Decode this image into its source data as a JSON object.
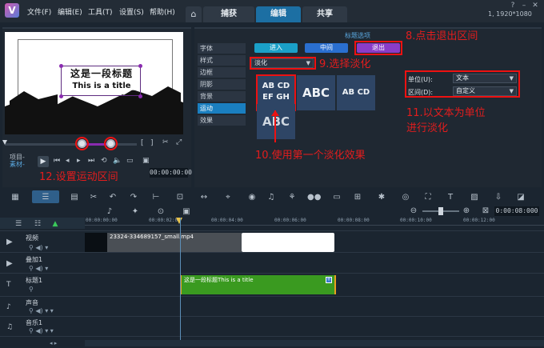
{
  "app": {
    "logo": "V",
    "resolution": "1, 1920*1080"
  },
  "menu": [
    "文件(F)",
    "编辑(E)",
    "工具(T)",
    "设置(S)",
    "帮助(H)"
  ],
  "nav_tabs": [
    "捕获",
    "编辑",
    "共享"
  ],
  "preview": {
    "title_line1": "这是一段标题",
    "title_line2": "This is a title",
    "project_label": "项目-",
    "clip_label": "素材-",
    "timecode": "00:00:00:00"
  },
  "annotations": {
    "a8": "8.点击退出区间",
    "a9": "9.选择淡化",
    "a10": "10.使用第一个淡化效果",
    "a11_line1": "11.以文本为单位",
    "a11_line2": "进行淡化",
    "a12": "12.设置运动区间"
  },
  "options_panel": {
    "header": "标题选项",
    "categories": [
      "字体",
      "样式",
      "边框",
      "阴影",
      "背景",
      "运动",
      "效果"
    ],
    "active_category": "运动",
    "direction_buttons": [
      "进入",
      "中间",
      "退出"
    ],
    "animation_type": "淡化",
    "effects": [
      {
        "line1": "AB CD",
        "line2": "EF GH"
      },
      {
        "line1": "ABC",
        "line2": ""
      },
      {
        "line1": "AB CD",
        "line2": ""
      },
      {
        "line1": "ABC",
        "line2": ""
      }
    ],
    "unit_label": "单位(U):",
    "unit_value": "文本",
    "range_label": "区间(D):",
    "range_value": "自定义"
  },
  "timeline": {
    "timecode": "0:00:08:000",
    "ruler": [
      "00:00:00:00",
      "00:00:02:00",
      "00:00:04:00",
      "00:00:06:00",
      "00:00:08:00",
      "00:00:10:00",
      "00:00:12:00"
    ],
    "tracks": [
      "视频",
      "叠加1",
      "标题1",
      "声音",
      "音乐1"
    ],
    "video_clip": "23324-334689157_small.mp4",
    "title_clip": "这是一段标题This is a title"
  },
  "colors": {
    "accent": "#1a7fc0",
    "enter": "#1aa0c8",
    "middle": "#2a6fd0",
    "exit": "#8a3cc8",
    "title_clip": "#3a9a20",
    "annotation": "#e31d1d"
  }
}
